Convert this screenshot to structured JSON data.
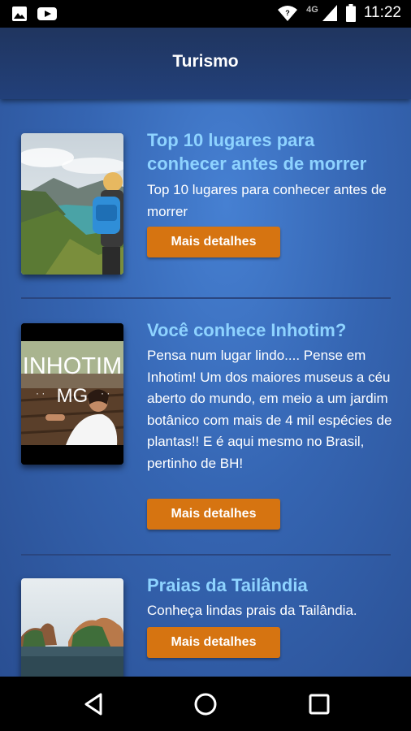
{
  "status_bar": {
    "time": "11:22",
    "network": "4G",
    "icons": [
      "image-notification-icon",
      "youtube-notification-icon",
      "wifi-icon",
      "cell-signal-icon",
      "battery-icon"
    ]
  },
  "app_bar": {
    "title": "Turismo"
  },
  "items": [
    {
      "title": "Top 10 lugares para conhecer antes de morrer",
      "description": "Top 10 lugares para conhecer antes de morrer",
      "button_label": "Mais detalhes"
    },
    {
      "title": "Você conhece Inhotim?",
      "description": "Pensa num lugar lindo.... Pense em Inhotim! Um dos maiores museus a céu aberto do mundo, em meio a um jardim botânico com mais de 4 mil espécies de plantas!! E é aqui mesmo no Brasil, pertinho de BH!",
      "button_label": "Mais detalhes",
      "image_overlay": {
        "line1": "INHOTIM",
        "line2": "MG"
      }
    },
    {
      "title": "Praias da Tailândia",
      "description": "Conheça lindas prais da Tailândia.",
      "button_label": "Mais detalhes"
    }
  ],
  "nav_bar": {
    "icons": [
      "back-icon",
      "home-icon",
      "recents-icon"
    ]
  },
  "colors": {
    "title": "#8ed3ff",
    "button": "#d67411",
    "app_bar": "#20355f",
    "content_bg": "#3565b2"
  }
}
